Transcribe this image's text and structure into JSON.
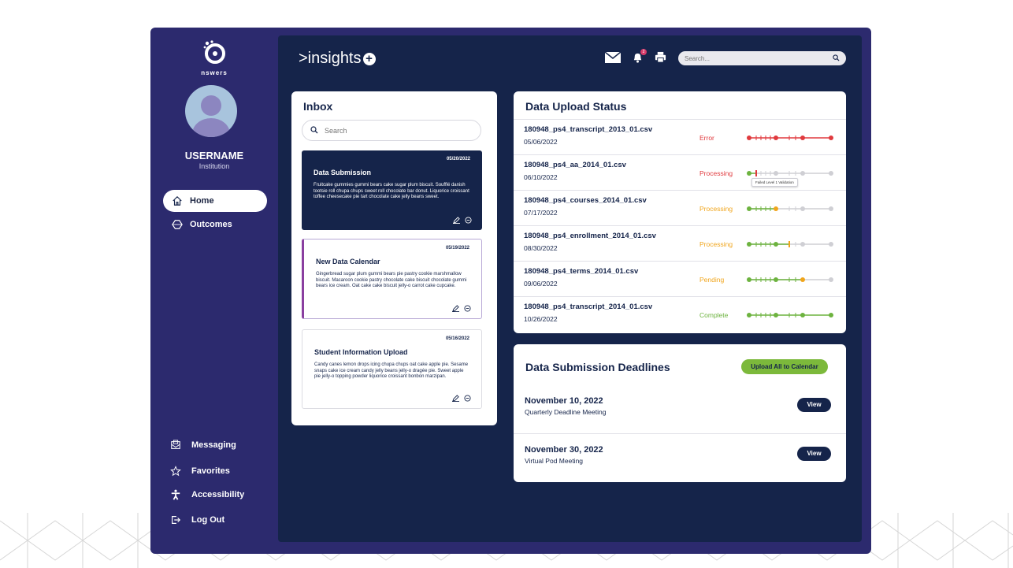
{
  "brand": {
    "logo_word": "nswers",
    "app_name": ">insights"
  },
  "user": {
    "name": "USERNAME",
    "institution": "Institution"
  },
  "sidebar": {
    "nav": [
      {
        "label": "Home",
        "icon": "home-icon",
        "active": true
      },
      {
        "label": "Outcomes",
        "icon": "hexagon-icon",
        "active": false
      }
    ],
    "bottom": [
      {
        "label": "Messaging",
        "icon": "messaging-icon"
      },
      {
        "label": "Favorites",
        "icon": "star-icon"
      },
      {
        "label": "Accessibility",
        "icon": "accessibility-icon"
      },
      {
        "label": "Log Out",
        "icon": "logout-icon"
      }
    ]
  },
  "header": {
    "search_placeholder": "Search...",
    "notification_count": "2"
  },
  "inbox": {
    "title": "Inbox",
    "search_placeholder": "Search",
    "messages": [
      {
        "date": "05/20/2022",
        "title": "Data Submission",
        "body": "Fruitcake gummies gummi bears cake sugar plum biscuit. Soufflé danish tootsie roll chupa chups sweet roll chocolate bar donut. Liquorice croissant toffee cheesecake pie tart chocolate cake jelly beans sweet."
      },
      {
        "date": "05/19/2022",
        "title": "New Data Calendar",
        "body": "Gingerbread sugar plum gummi bears pie pastry cookie marshmallow biscuit. Macaroon cookie pastry chocolate cake biscuit chocolate gummi bears ice cream. Oat cake cake biscuit jelly-o carrot cake cupcake."
      },
      {
        "date": "05/16/2022",
        "title": "Student Information Upload",
        "body": "Candy canes lemon drops icing chupa chups oat cake apple pie. Sesame snaps cake ice cream candy jelly beans jelly-o dragée pie. Sweet apple pie jelly-o topping powder liquorice croissant bonbon marzipan."
      }
    ]
  },
  "upload_status": {
    "title": "Data Upload Status",
    "tooltip": "Failed Level 1 Validation",
    "rows": [
      {
        "file": "180948_ps4_transcript_2013_01.csv",
        "date": "05/06/2022",
        "status": "Error",
        "status_color": "#e03a3e"
      },
      {
        "file": "180948_ps4_aa_2014_01.csv",
        "date": "06/10/2022",
        "status": "Processing",
        "status_color": "#e03a3e"
      },
      {
        "file": "180948_ps4_courses_2014_01.csv",
        "date": "07/17/2022",
        "status": "Processing",
        "status_color": "#f0a51c"
      },
      {
        "file": "180948_ps4_enrollment_2014_01.csv",
        "date": "08/30/2022",
        "status": "Processing",
        "status_color": "#f0a51c"
      },
      {
        "file": "180948_ps4_terms_2014_01.csv",
        "date": "09/06/2022",
        "status": "Pending",
        "status_color": "#f0a51c"
      },
      {
        "file": "180948_ps4_transcript_2014_01.csv",
        "date": "10/26/2022",
        "status": "Complete",
        "status_color": "#6db33f"
      }
    ]
  },
  "deadlines": {
    "title": "Data Submission Deadlines",
    "upload_all_label": "Upload All to Calendar",
    "items": [
      {
        "date": "November 10, 2022",
        "name": "Quarterly Deadline Meeting",
        "button": "View"
      },
      {
        "date": "November 30, 2022",
        "name": "Virtual Pod Meeting",
        "button": "View"
      }
    ]
  }
}
